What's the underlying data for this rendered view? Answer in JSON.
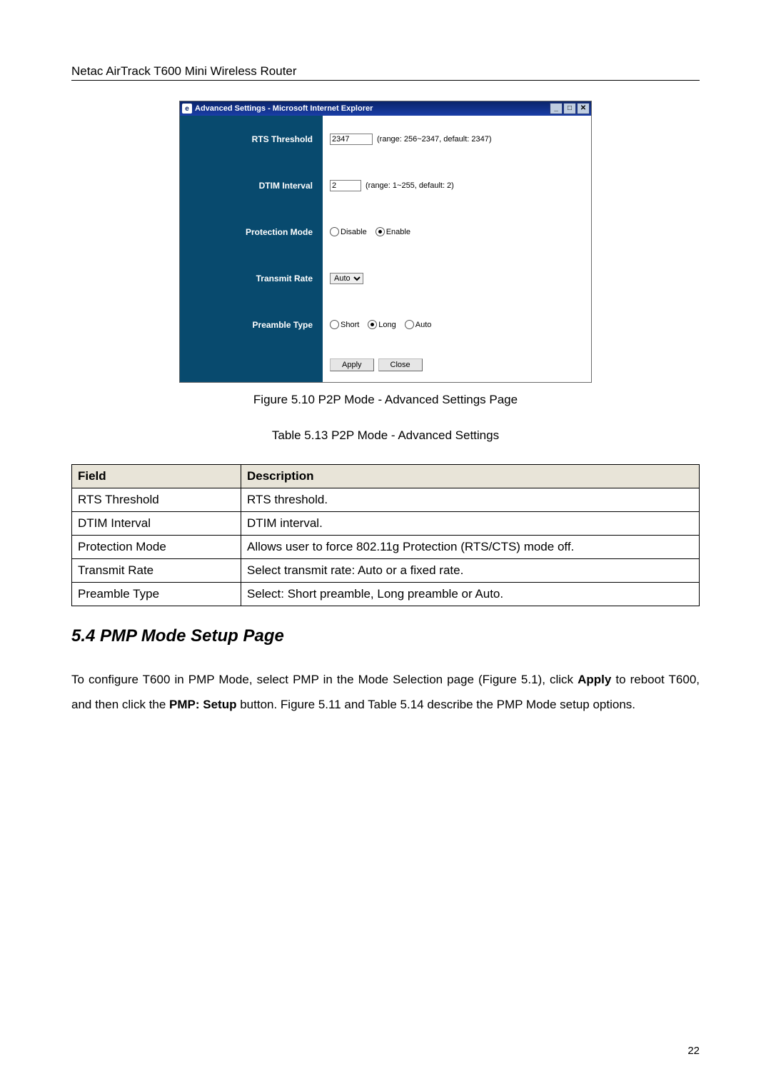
{
  "header": "Netac AirTrack T600 Mini Wireless Router",
  "figure": {
    "window_title": "Advanced Settings - Microsoft Internet Explorer",
    "ie_icon_text": "e",
    "win_min": "_",
    "win_max": "□",
    "win_close": "✕",
    "rows": {
      "rts": {
        "label": "RTS Threshold",
        "value": "2347",
        "hint": "(range: 256~2347, default: 2347)"
      },
      "dtim": {
        "label": "DTIM Interval",
        "value": "2",
        "hint": "(range: 1~255, default: 2)"
      },
      "prot": {
        "label": "Protection Mode",
        "disable": "Disable",
        "enable": "Enable"
      },
      "rate": {
        "label": "Transmit Rate",
        "value": "Auto"
      },
      "preamble": {
        "label": "Preamble Type",
        "short": "Short",
        "long": "Long",
        "auto": "Auto"
      }
    },
    "buttons": {
      "apply": "Apply",
      "close": "Close"
    }
  },
  "figure_caption": "Figure 5.10 P2P Mode - Advanced Settings Page",
  "table_caption": "Table 5.13 P2P Mode - Advanced Settings",
  "table": {
    "head": {
      "field": "Field",
      "description": "Description"
    },
    "rows": [
      {
        "field": "RTS Threshold",
        "description": "RTS threshold."
      },
      {
        "field": "DTIM Interval",
        "description": "DTIM interval."
      },
      {
        "field": "Protection Mode",
        "description": "Allows user to force 802.11g Protection (RTS/CTS) mode off."
      },
      {
        "field": "Transmit Rate",
        "description": "Select transmit rate: Auto or a fixed rate."
      },
      {
        "field": "Preamble Type",
        "description": "Select: Short preamble, Long preamble or Auto."
      }
    ]
  },
  "section_heading": "5.4 PMP Mode Setup Page",
  "paragraph": {
    "p1a": "To configure T600 in PMP Mode, select PMP in the Mode Selection page (Figure 5.1), click ",
    "p1b": "Apply",
    "p1c": " to reboot T600, and then click the ",
    "p1d": "PMP: Setup",
    "p1e": " button. Figure 5.11 and Table 5.14 describe the PMP Mode setup options."
  },
  "page_number": "22"
}
